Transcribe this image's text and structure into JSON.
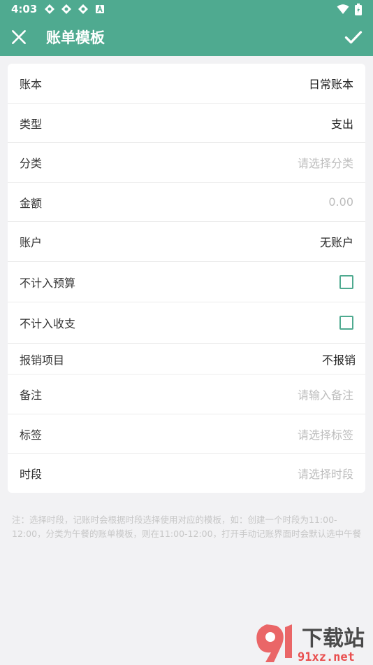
{
  "status": {
    "time": "4:03"
  },
  "appbar": {
    "title": "账单模板"
  },
  "form": {
    "account_book": {
      "label": "账本",
      "value": "日常账本"
    },
    "type": {
      "label": "类型",
      "value": "支出"
    },
    "category": {
      "label": "分类",
      "placeholder": "请选择分类"
    },
    "amount": {
      "label": "金额",
      "placeholder": "0.00"
    },
    "account": {
      "label": "账户",
      "value": "无账户"
    },
    "exclude_budget": {
      "label": "不计入预算"
    },
    "exclude_income_expense": {
      "label": "不计入收支"
    },
    "reimburse": {
      "label": "报销项目",
      "value": "不报销"
    },
    "remark": {
      "label": "备注",
      "placeholder": "请输入备注"
    },
    "tags": {
      "label": "标签",
      "placeholder": "请选择标签"
    },
    "time_period": {
      "label": "时段",
      "placeholder": "请选择时段"
    }
  },
  "note": "注：选择时段，记账时会根据时段选择使用对应的模板，如：创建一个时段为11:00-12:00，分类为午餐的账单模板，则在11:00-12:00，打开手动记账界面时会默认选中午餐",
  "watermark": {
    "brand": "下载站",
    "domain": "91xz.net"
  },
  "colors": {
    "accent": "#4faa90",
    "background": "#f2f2f4"
  }
}
